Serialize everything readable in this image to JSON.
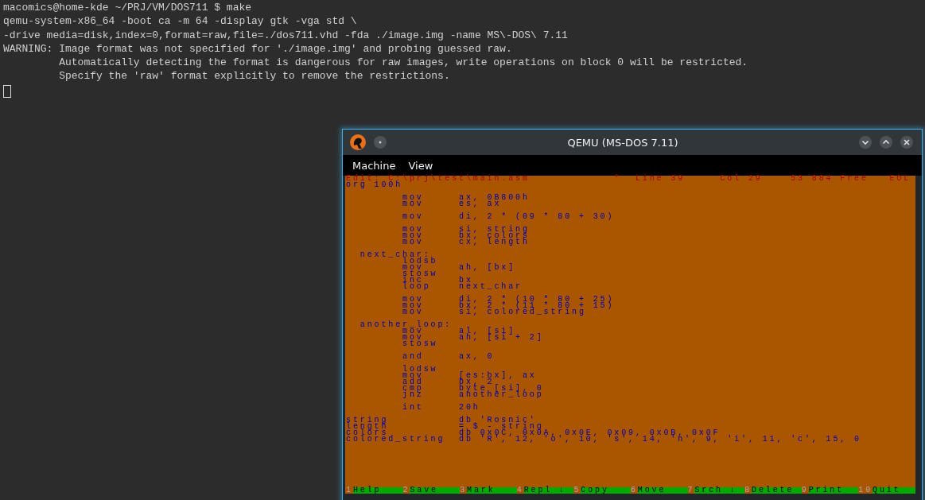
{
  "terminal": {
    "lines": [
      "macomics@home-kde ~/PRJ/VM/DOS711 $ make",
      "qemu-system-x86_64 -boot ca -m 64 -display gtk -vga std \\",
      "-drive media=disk,index=0,format=raw,file=./dos711.vhd -fda ./image.img -name MS\\-DOS\\ 7.11",
      "WARNING: Image format was not specified for './image.img' and probing guessed raw.",
      "         Automatically detecting the format is dangerous for raw images, write operations on block 0 will be restricted.",
      "         Specify the 'raw' format explicitly to remove the restrictions."
    ],
    "cursor": true
  },
  "window": {
    "title": "QEMU (MS-DOS 7.11)",
    "menu": [
      "Machine",
      "View"
    ],
    "editor": {
      "status": {
        "file": "Edit: C:\\prj\\test\\main.asm",
        "modified": "*",
        "line": "Line 39",
        "col": "Col 29",
        "free": "53 884 Free",
        "eol": "EOL"
      },
      "blocks": [
        [
          "org 100h"
        ],
        [
          "        mov     ax, 0B800h",
          "        mov     es, ax"
        ],
        [
          "        mov     di, 2 * (09 * 80 + 30)"
        ],
        [
          "        mov     si, string",
          "        mov     bx, colors",
          "        mov     cx, length"
        ],
        [
          "  next_char:",
          "        lodsb",
          "        mov     ah, [bx]",
          "        stosw",
          "        inc     bx",
          "        loop    next_char"
        ],
        [
          "        mov     di, 2 * (10 * 80 + 25)",
          "        mov     bx, 2 * (11 * 80 + 15)",
          "        mov     si, colored_string"
        ],
        [
          "  another_loop:",
          "        mov     al, [si]",
          "        mov     ah, [si + 2]",
          "        stosw"
        ],
        [
          "        and     ax, 0"
        ],
        [
          "        lodsw",
          "        mov     [es:bx], ax",
          "        add     bx, 2",
          "        cmp     byte [si], 0",
          "        jnz     another_loop"
        ],
        [
          "        int     20h"
        ],
        [
          "string          db 'Rosnic'",
          "length          = $ - string",
          "colors          db 0x0C, 0x0A, 0x0E, 0x09, 0x0B, 0x0F",
          "colored_string  db 'R', 12, 'o', 10, 's', 14, 'n', 9, 'i', 11, 'c', 15, 0"
        ]
      ],
      "function_keys": [
        {
          "number": "1",
          "label": "Help"
        },
        {
          "number": "2",
          "label": "Save"
        },
        {
          "number": "3",
          "label": "Mark"
        },
        {
          "number": "4",
          "label": "Repl ↓"
        },
        {
          "number": "5",
          "label": "Copy"
        },
        {
          "number": "6",
          "label": "Move"
        },
        {
          "number": "7",
          "label": "Srch ↓"
        },
        {
          "number": "8",
          "label": "Delete"
        },
        {
          "number": "9",
          "label": "Print"
        },
        {
          "number": "10",
          "label": "Quit"
        }
      ]
    }
  }
}
